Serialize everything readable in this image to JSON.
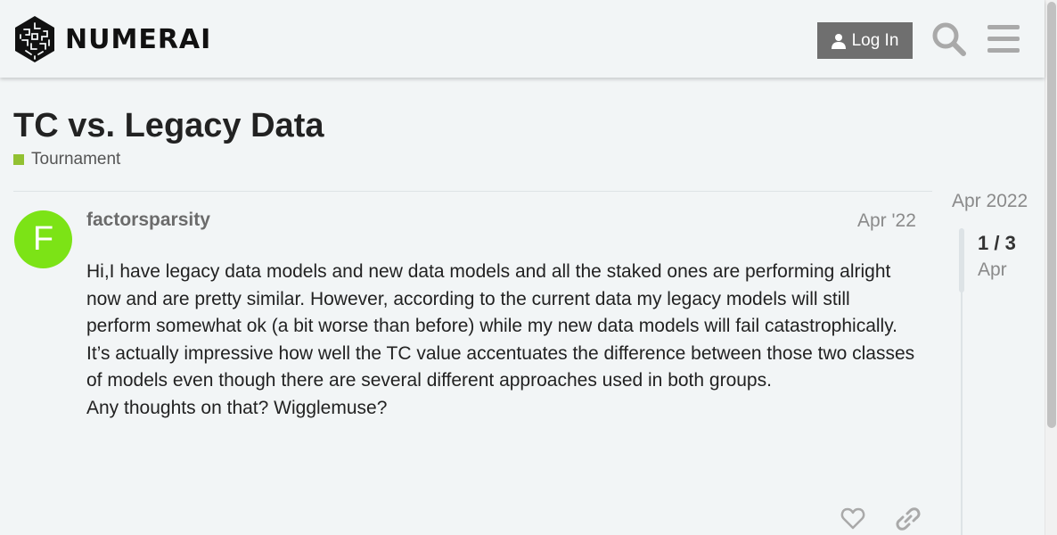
{
  "header": {
    "logo_text": "NUMERAI",
    "login_label": "Log In",
    "search_icon": "search-icon",
    "menu_icon": "hamburger-menu-icon"
  },
  "topic": {
    "title": "TC vs. Legacy Data",
    "category": {
      "name": "Tournament",
      "color": "#92c132"
    }
  },
  "post": {
    "avatar_letter": "F",
    "avatar_color": "#7ce316",
    "username": "factorsparsity",
    "date": "Apr '22",
    "paragraphs": [
      "Hi,I have legacy data models and new data models and all the staked ones are performing alright now and are pretty similar. However, according to the current data my legacy models will still perform somewhat ok (a bit worse than before) while my new data models will fail catastrophically. It’s actually impressive how well the TC value accentuates the difference between those two classes of models even though there are several different approaches used in both groups.",
      "Any thoughts on that? Wigglemuse?"
    ],
    "actions": {
      "like_icon": "heart-icon",
      "link_icon": "link-icon"
    }
  },
  "timeline": {
    "top_date": "Apr 2022",
    "position": "1 / 3",
    "current_date": "Apr"
  },
  "colors": {
    "background": "#f2f5f6",
    "button": "#6f6f6f",
    "icon": "#a9a9a9"
  }
}
